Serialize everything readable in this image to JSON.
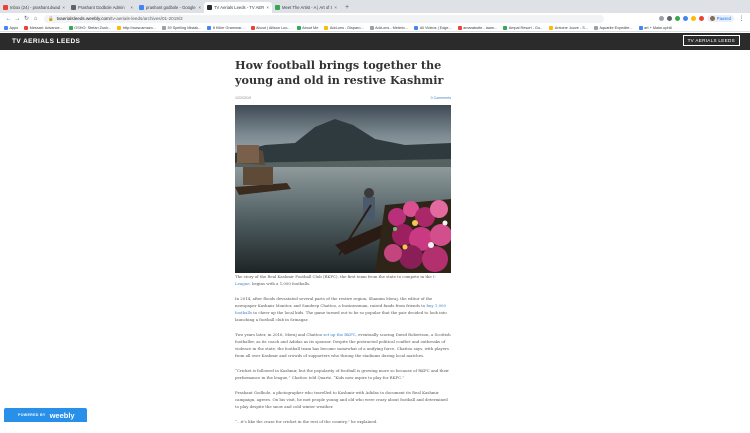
{
  "tabs": [
    {
      "label": "Inbox (24) - prashant.dwadik",
      "color": "#ea4335",
      "active": false
    },
    {
      "label": "Prashant Godbole Admin",
      "color": "#5f6368",
      "active": false
    },
    {
      "label": "prashant godbole - Google Se",
      "color": "#4285f4",
      "active": false
    },
    {
      "label": "TV Aerials Leeds - TV AERIAL",
      "color": "#2b2b2b",
      "active": true
    },
    {
      "label": "Meet The Artist - A | Art of Su",
      "color": "#34a853",
      "active": false
    }
  ],
  "toolbar": {
    "url_domain": "tvaerialsleeds.weebly.com",
    "url_path": "/tv-aerials-leeds/archives/01-2019/2",
    "paused_label": "Paused"
  },
  "bookmarks": [
    "Apps",
    "Messari: Advance...",
    "OSHO: Stefan Zush...",
    "http://www.amazo...",
    "39 Spelling Mistak...",
    "8 Killer Grammar...",
    "About | Allison Loo...",
    "About Me",
    "Add-ons - Disparo...",
    "Add-ons - Meteric...",
    "All Videos | Edge...",
    "amarabutte - iaam...",
    "Ampal Resort - Go...",
    "Antoine Jouve - S...",
    "Aquarite Expedite...",
    "art + Make.uphill"
  ],
  "site": {
    "title": "TV AERIALS LEEDS",
    "header_button": "TV AERIALS LEEDS"
  },
  "post": {
    "title": "How football brings together the young and old in restive Kashmir",
    "date": "1/22/2019",
    "comments": "0 Comments",
    "p1_a": "The story of the Real Kashmir Football Club (RKFC), the first team from the state to compete in the ",
    "p1_link": "I-League",
    "p1_b": ", begins with a 1,000 footballs.",
    "p2_a": "In 2014, after floods devastated several parts of the restive region, Shamim Meraj, the editor of the newspaper Kashmir Monitor, and Sandeep Chattoo, a businessman, raised funds from friends to ",
    "p2_link": "buy 1,000 footballs",
    "p2_b": " to cheer up the local kids. The game turned out to be so popular that the pair decided to look into launching a football club in Srinagar.",
    "p3_a": "Two years later, in 2016, Meraj and Chattoo ",
    "p3_link": "set up the RKFC",
    "p3_b": ", eventually scoring David Robertson, a Scottish footballer, as its coach and Adidas as its sponsor. Despite the protracted political conflict and outbreaks of violence in the state, the football team has become somewhat of a unifying force. Chattoo says, with players from all over Kashmir and crowds of supporters who throng the stadiums during local matches.",
    "p4": "“Cricket is followed in Kashmir, but the popularity of football is growing more so because of RKFC and their performance in the league,” Chattoo told Quartz. “Kids now aspire to play for RKFC.”",
    "p5": "Prashant Godbole, a photographer who travelled to Kashmir with Adidas to document its Real Kashmir campaign, agrees. On his visit, he met people young and old who were crazy about football and determined to play despite the snow and cold winter weather.",
    "p6": "“...it’s like the craze for cricket in the rest of the country,” he explained."
  },
  "badge": {
    "powered_by": "POWERED BY",
    "logo": "weebly"
  }
}
